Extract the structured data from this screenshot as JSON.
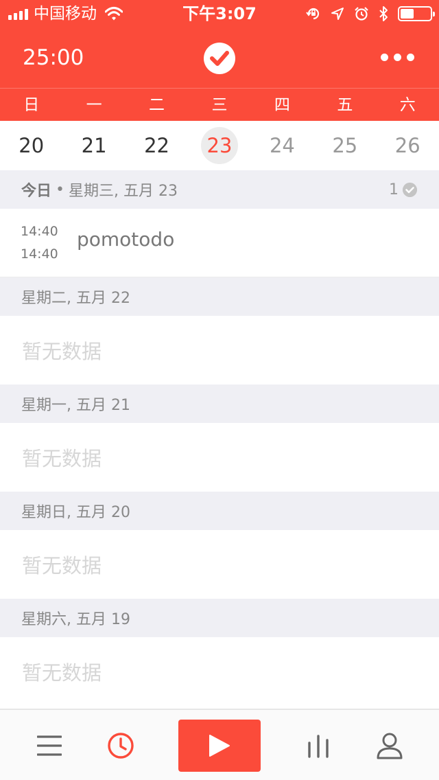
{
  "status_bar": {
    "carrier": "中国移动",
    "time": "下午3:07",
    "battery_level": 0.45
  },
  "header": {
    "timer": "25:00",
    "logo_icon": "checkmark-circle-icon",
    "more_icon": "more-dots-icon"
  },
  "colors": {
    "accent": "#fb4b3a",
    "section_bg": "#efeff4",
    "today_circle": "#ececec"
  },
  "calendar": {
    "weekdays": [
      "日",
      "一",
      "二",
      "三",
      "四",
      "五",
      "六"
    ],
    "dates": [
      "20",
      "21",
      "22",
      "23",
      "24",
      "25",
      "26"
    ],
    "selected": "23"
  },
  "sections": [
    {
      "today_label": "今日",
      "dot": "•",
      "date_label": "星期三, 五月 23",
      "count": "1",
      "entries": [
        {
          "start": "14:40",
          "end": "14:40",
          "title": "pomotodo"
        }
      ]
    },
    {
      "date_label": "星期二, 五月 22",
      "empty_text": "暂无数据"
    },
    {
      "date_label": "星期一, 五月 21",
      "empty_text": "暂无数据"
    },
    {
      "date_label": "星期日, 五月 20",
      "empty_text": "暂无数据"
    },
    {
      "date_label": "星期六, 五月 19",
      "empty_text": "暂无数据"
    }
  ],
  "tabbar": {
    "items": [
      "menu-icon",
      "history-clock-icon",
      "play-icon",
      "stats-bars-icon",
      "profile-icon"
    ],
    "active": "history-clock-icon"
  }
}
